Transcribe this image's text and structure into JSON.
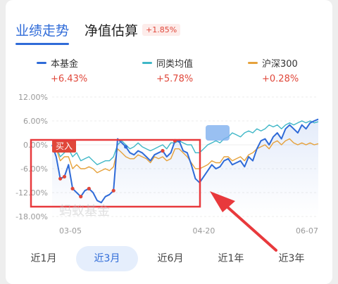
{
  "tabs": {
    "performance": "业绩走势",
    "estimate": "净值估算",
    "estimate_change": "+1.85%"
  },
  "legend": [
    {
      "name": "本基金",
      "value": "+6.43%",
      "color": "#2f6bd8"
    },
    {
      "name": "同类均值",
      "value": "+5.78%",
      "color": "#3fb7c7"
    },
    {
      "name": "沪深300",
      "value": "+0.28%",
      "color": "#e6a23c"
    }
  ],
  "buy_marker": "买入",
  "watermark": "蚂蚁基金",
  "periods": [
    "近1月",
    "近3月",
    "近6月",
    "近1年",
    "近3年"
  ],
  "active_period": "近3月",
  "chart_data": {
    "type": "line",
    "ytick_labels": [
      "12.00%",
      "6.00%",
      "0.00%",
      "-6.00%",
      "-12.00%",
      "-18.00%"
    ],
    "ylim": [
      -18,
      12
    ],
    "xtick_labels": [
      "03-05",
      "04-20",
      "06-07"
    ],
    "x": [
      0,
      1,
      2,
      3,
      4,
      5,
      6,
      7,
      8,
      9,
      10,
      11,
      12,
      13,
      14,
      15,
      16,
      17,
      18,
      19,
      20,
      21,
      22,
      23,
      24,
      25,
      26,
      27,
      28,
      29,
      30,
      31,
      32,
      33,
      34,
      35,
      36,
      37,
      38,
      39,
      40,
      41,
      42,
      43,
      44,
      45,
      46,
      47,
      48,
      49,
      50,
      51,
      52,
      53,
      54,
      55,
      56,
      57,
      58,
      59,
      60,
      61,
      62,
      63,
      64,
      65
    ],
    "series": [
      {
        "name": "本基金",
        "color": "#2f6bd8",
        "values": [
          0,
          -3,
          -8.5,
          -8,
          -5,
          -11,
          -12,
          -13,
          -11.5,
          -11,
          -12,
          -14,
          -14.5,
          -13,
          -12.5,
          -11.5,
          1.5,
          0.5,
          -0.5,
          -2,
          -2.5,
          -1.5,
          -2,
          -3,
          -4,
          -2.5,
          -2,
          -1.5,
          -3,
          -2,
          1,
          1,
          -1.5,
          -2,
          -5,
          -8.5,
          -9.5,
          -8,
          -6.5,
          -5,
          -6,
          -5.5,
          -4,
          -3.5,
          -5,
          -4.5,
          -4,
          -5.5,
          -3,
          -4,
          -1,
          1,
          1.5,
          0,
          2,
          3,
          1.5,
          4,
          5,
          4,
          3,
          5,
          4,
          5.5,
          6,
          6.43
        ]
      },
      {
        "name": "同类均值",
        "color": "#3fb7c7",
        "values": [
          0,
          -0.5,
          -3,
          -2,
          -1,
          -3,
          -2,
          -4,
          -3.5,
          -3,
          -4,
          -5,
          -4.5,
          -4,
          -4,
          -3,
          0,
          1,
          0,
          -1,
          -0.5,
          0.5,
          -0.5,
          -1,
          -1.5,
          -1,
          -0.5,
          0,
          -1,
          0.5,
          0.5,
          1,
          0.5,
          0,
          0,
          -2,
          -2,
          -1,
          0,
          0.5,
          1,
          0.5,
          1.5,
          2,
          3,
          2.5,
          2,
          3,
          3.5,
          3,
          4,
          3.5,
          4,
          5,
          4.5,
          5,
          4,
          5,
          5.5,
          5,
          5.5,
          6,
          5.5,
          6,
          5.5,
          5.78
        ]
      },
      {
        "name": "沪深300",
        "color": "#e6a23c",
        "values": [
          0,
          -1,
          -4,
          -3,
          -3,
          -6,
          -5,
          -6,
          -6,
          -5.5,
          -6,
          -7,
          -6.5,
          -6,
          -6.5,
          -5.5,
          -1,
          -2,
          -3,
          -3.5,
          -3.5,
          -2.5,
          -3,
          -3.5,
          -4.5,
          -3,
          -3.5,
          -3,
          -4,
          -3.5,
          -1,
          -1,
          -2,
          -3,
          -4.5,
          -6,
          -6,
          -5.5,
          -5,
          -4,
          -4.5,
          -4.5,
          -3,
          -3,
          -4,
          -3.5,
          -3,
          -4,
          -2.5,
          -2,
          -1,
          -0.5,
          0,
          -1,
          0.5,
          1,
          0,
          1,
          1.5,
          0.5,
          0,
          0.5,
          0,
          0.5,
          0,
          0.28
        ]
      }
    ]
  }
}
